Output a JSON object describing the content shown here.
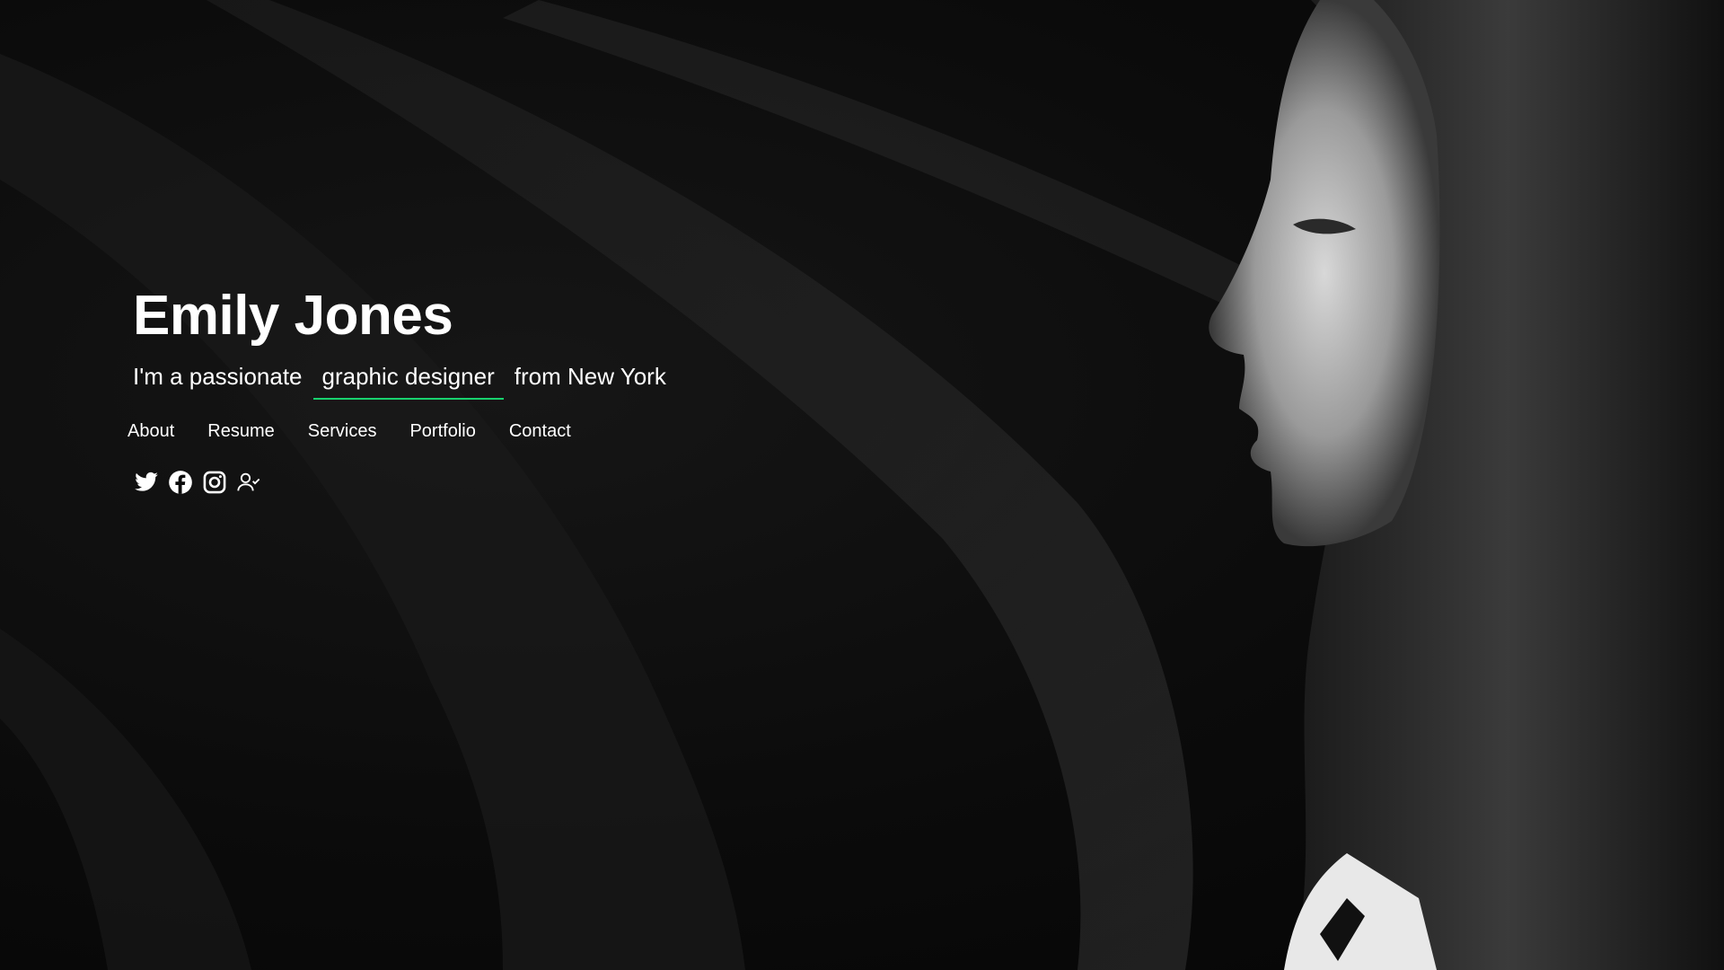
{
  "hero": {
    "name": "Emily Jones",
    "tagline_prefix": "I'm a passionate",
    "tagline_typed": "graphic designer",
    "tagline_suffix": "from New York",
    "accent_color": "#18d26e"
  },
  "nav": {
    "items": [
      {
        "label": "About"
      },
      {
        "label": "Resume"
      },
      {
        "label": "Services"
      },
      {
        "label": "Portfolio"
      },
      {
        "label": "Contact"
      }
    ]
  },
  "social": {
    "icons": [
      "twitter-icon",
      "facebook-icon",
      "instagram-icon",
      "user-check-icon"
    ]
  }
}
